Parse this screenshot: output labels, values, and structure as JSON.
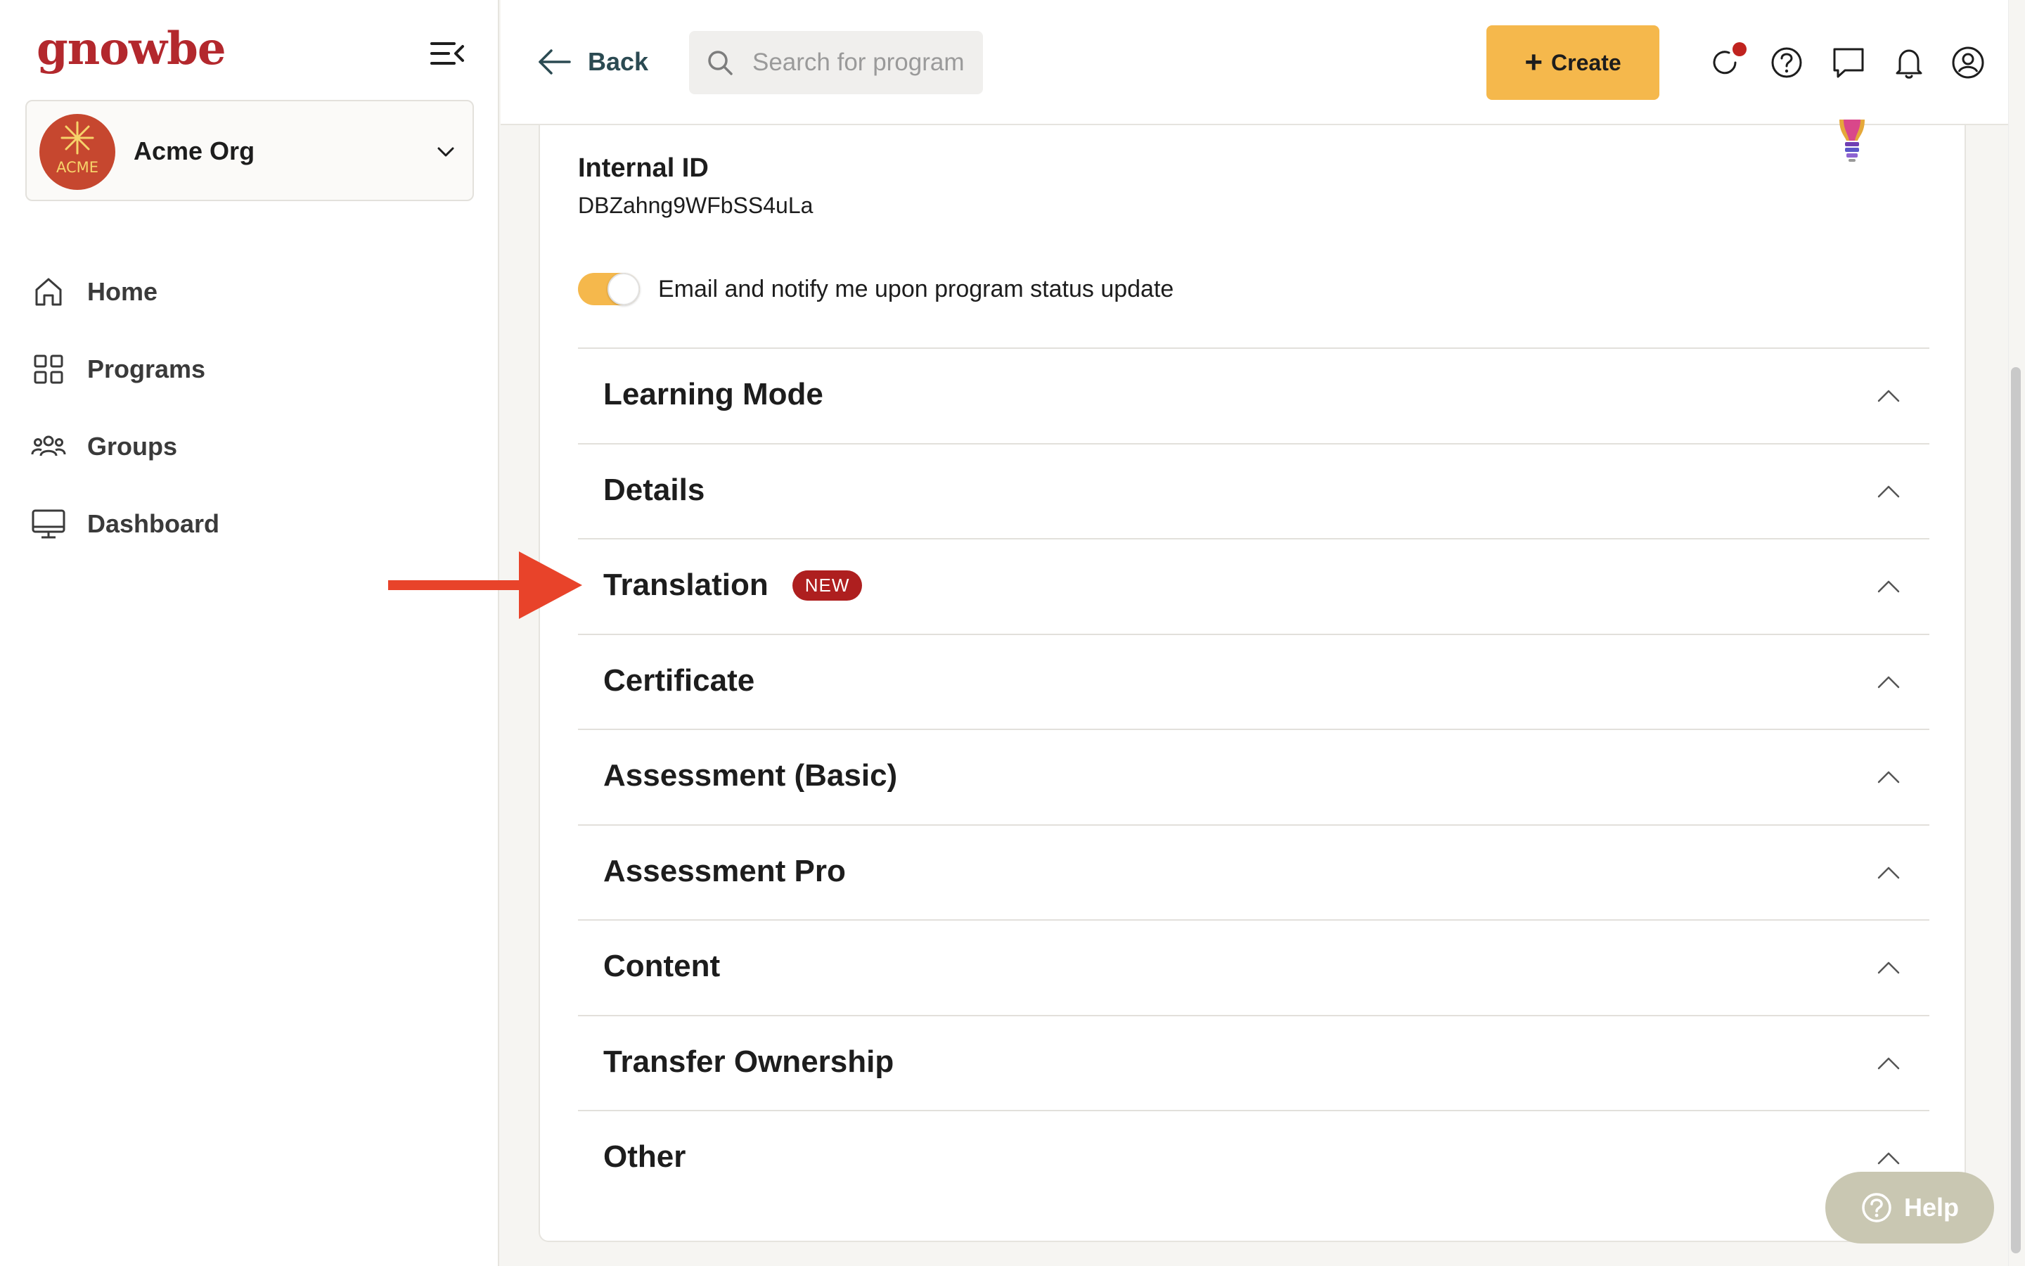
{
  "app": {
    "logo_text": "gnowbe",
    "brand_color": "#b3282d",
    "accent_color": "#f5b84c"
  },
  "sidebar": {
    "org": {
      "name": "Acme Org",
      "avatar_text": "ACME"
    },
    "items": [
      {
        "label": "Home",
        "icon": "home-icon"
      },
      {
        "label": "Programs",
        "icon": "grid-icon"
      },
      {
        "label": "Groups",
        "icon": "users-icon"
      },
      {
        "label": "Dashboard",
        "icon": "monitor-icon"
      }
    ]
  },
  "topbar": {
    "back_label": "Back",
    "search_placeholder": "Search for programs",
    "create_label": "Create",
    "icons": [
      "refresh-icon",
      "help-circle-icon",
      "chat-icon",
      "bell-icon",
      "account-icon"
    ]
  },
  "main": {
    "internal_id_label": "Internal ID",
    "internal_id_value": "DBZahng9WFbSS4uLa",
    "notify_label": "Email and notify me upon program status update",
    "notify_enabled": true,
    "sections": [
      {
        "title": "Learning Mode"
      },
      {
        "title": "Details"
      },
      {
        "title": "Translation",
        "badge": "NEW"
      },
      {
        "title": "Certificate"
      },
      {
        "title": "Assessment (Basic)"
      },
      {
        "title": "Assessment Pro"
      },
      {
        "title": "Content"
      },
      {
        "title": "Transfer Ownership"
      },
      {
        "title": "Other"
      }
    ]
  },
  "help": {
    "label": "Help"
  }
}
